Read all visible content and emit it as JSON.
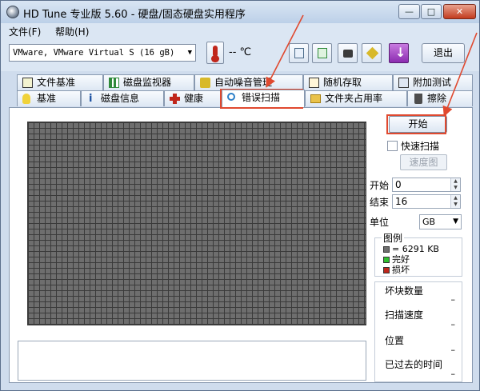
{
  "window": {
    "title": "HD Tune 专业版 5.60 - 硬盘/固态硬盘实用程序",
    "minimize": "—",
    "maximize": "□",
    "close": "✕"
  },
  "menu": [
    {
      "label": "文件(F)"
    },
    {
      "label": "帮助(H)"
    }
  ],
  "toolbar": {
    "drive": "VMware, VMware Virtual S (16 gB)",
    "temperature": "-- ℃",
    "exit_label": "退出",
    "download_glyph": "↓"
  },
  "tabs_row1": [
    "文件基准",
    "磁盘监视器",
    "自动噪音管理",
    "随机存取",
    "附加测试"
  ],
  "tabs_row2": [
    "基准",
    "磁盘信息",
    "健康",
    "错误扫描",
    "文件夹占用率",
    "擦除"
  ],
  "active_tab": "错误扫描",
  "scan": {
    "start_button": "开始",
    "quick_scan_label": "快速扫描",
    "quick_scan_checked": false,
    "speed_map_button": "速度图",
    "start_label": "开始",
    "start_value": "0",
    "end_label": "结束",
    "end_value": "16",
    "unit_label": "单位",
    "unit_value": "GB"
  },
  "legend": {
    "title": "图例",
    "block_size": "= 6291 KB",
    "ok": "完好",
    "damaged": "损坏"
  },
  "stats": {
    "bad_blocks_label": "坏块数量",
    "bad_blocks_value": "–",
    "scan_speed_label": "扫描速度",
    "scan_speed_value": "–",
    "position_label": "位置",
    "position_value": "–",
    "elapsed_label": "已过去的时间",
    "elapsed_value": "–"
  },
  "colors": {
    "annotation": "#e0492f",
    "block_gray": "#6e6e6e",
    "ok_green": "#2fbf2f",
    "bad_red": "#c0261b"
  }
}
